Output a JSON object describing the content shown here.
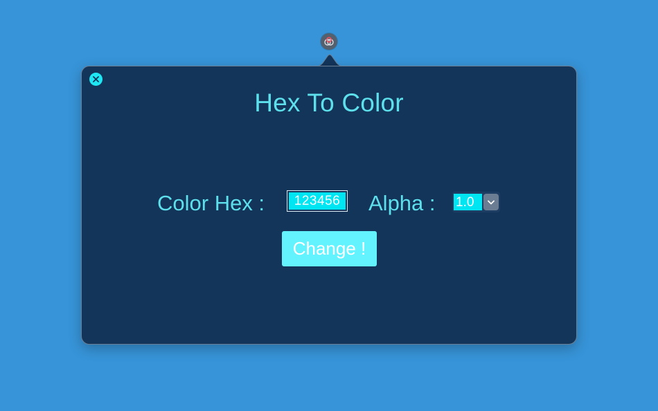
{
  "status_item": {
    "icon": "linked-circles-icon"
  },
  "popover": {
    "close_icon": "close-icon",
    "title": "Hex To Color",
    "color_hex_label": "Color Hex :",
    "color_hex_value": "123456",
    "alpha_label": "Alpha :",
    "alpha_selected": "1.0",
    "alpha_dropdown_icon": "chevron-down-icon",
    "change_button_label": "Change !"
  },
  "colors": {
    "desktop_background": "#3794d8",
    "popover_background": "#13355a",
    "accent_text": "#5ee0ec",
    "input_fill": "#00e5f2",
    "button_fill": "#63f3ff"
  }
}
